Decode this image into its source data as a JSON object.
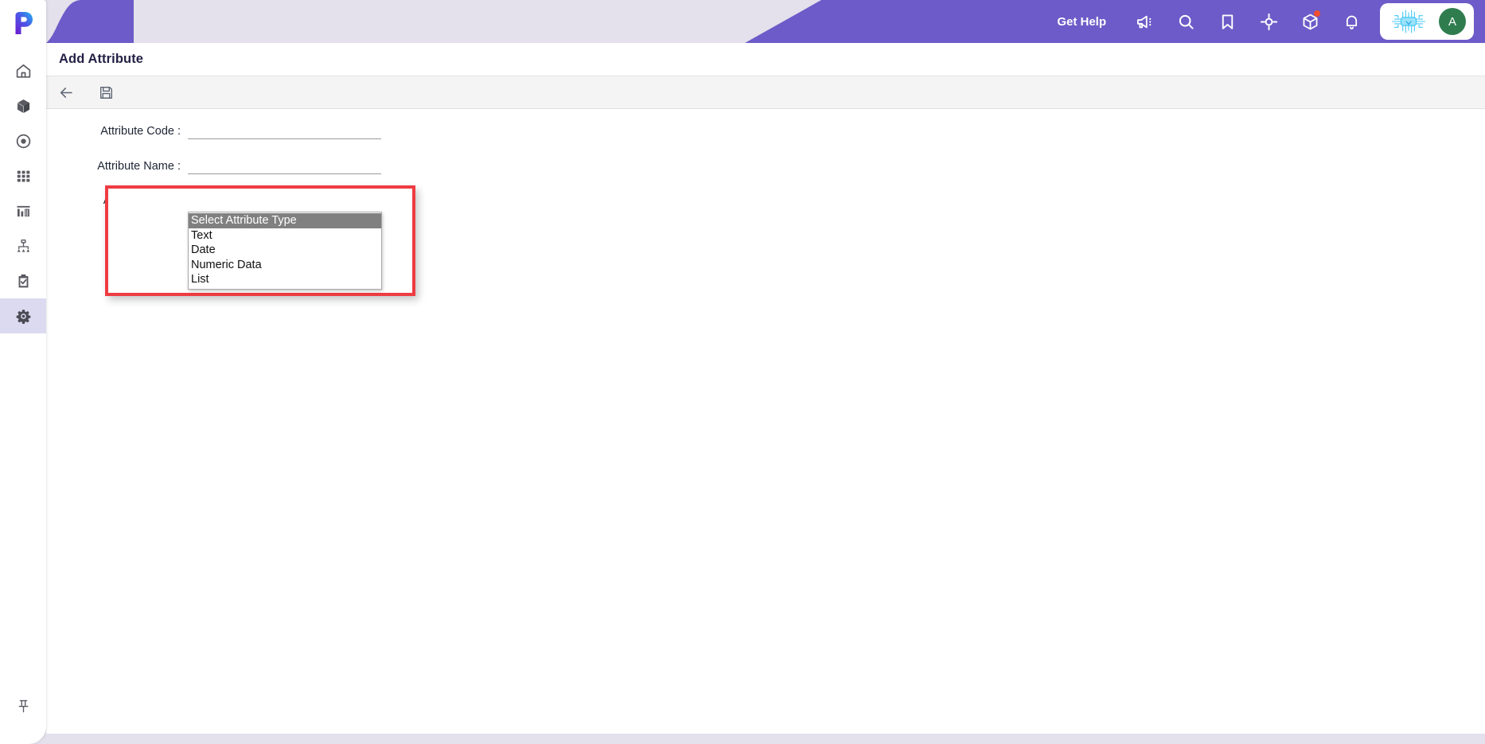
{
  "app": {
    "logo_letter": "P",
    "accent_purple": "#6c5bc8",
    "page_background": "#e4e0ec",
    "annotation_color": "#ef3b42"
  },
  "sidebar": {
    "items": [
      {
        "icon": "home-icon",
        "label": "Home",
        "active": false
      },
      {
        "icon": "cube-icon",
        "label": "Products",
        "active": false
      },
      {
        "icon": "target-icon",
        "label": "Target",
        "active": false
      },
      {
        "icon": "grid-icon",
        "label": "Grid",
        "active": false
      },
      {
        "icon": "bar-chart-icon",
        "label": "Reports",
        "active": false
      },
      {
        "icon": "sitemap-icon",
        "label": "Hierarchy",
        "active": false
      },
      {
        "icon": "clipboard-check-icon",
        "label": "Tasks",
        "active": false
      },
      {
        "icon": "gear-icon",
        "label": "Settings",
        "active": true
      }
    ],
    "pin": {
      "icon": "pushpin-icon",
      "label": "Pin sidebar"
    }
  },
  "header": {
    "get_help_label": "Get Help",
    "icons": [
      {
        "name": "megaphone-icon",
        "label": "Announcements",
        "badge": false
      },
      {
        "name": "search-icon",
        "label": "Search",
        "badge": false
      },
      {
        "name": "bookmark-icon",
        "label": "Bookmarks",
        "badge": false
      },
      {
        "name": "crosshair-icon",
        "label": "Quick Launch",
        "badge": false
      },
      {
        "name": "package-icon",
        "label": "Packages",
        "badge": true
      },
      {
        "name": "bell-icon",
        "label": "Notifications",
        "badge": false
      }
    ],
    "ai_assistant": {
      "icon": "ai-chip-icon",
      "label": "AI Assistant",
      "color": "#44c8f5"
    },
    "avatar": {
      "initial": "A",
      "color": "#2f7d4f"
    }
  },
  "page": {
    "title": "Add Attribute"
  },
  "toolbar": {
    "buttons": [
      {
        "name": "back-button",
        "icon": "arrow-left-icon",
        "label": "Back"
      },
      {
        "name": "save-button",
        "icon": "floppy-disk-icon",
        "label": "Save"
      }
    ]
  },
  "form": {
    "attribute_code": {
      "label": "Attribute Code :",
      "value": "",
      "placeholder": ""
    },
    "attribute_name": {
      "label": "Attribute Name :",
      "value": "",
      "placeholder": ""
    },
    "attribute_type": {
      "label": "Attribute Type :",
      "selected": "Select Attribute Type",
      "expanded": true,
      "options": [
        "Select Attribute Type",
        "Text",
        "Date",
        "Numeric Data",
        "List"
      ]
    }
  }
}
